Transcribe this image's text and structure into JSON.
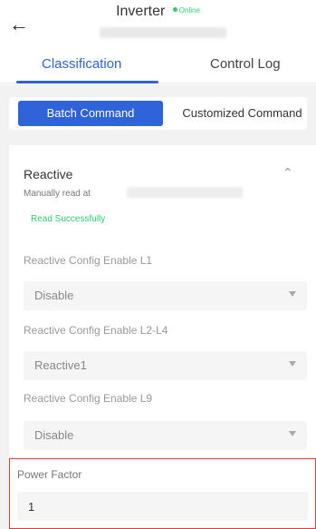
{
  "header": {
    "title": "Inverter",
    "status": "Online",
    "back_icon": "arrow-left-icon"
  },
  "tabs": [
    {
      "label": "Classification",
      "active": true
    },
    {
      "label": "Control Log",
      "active": false
    }
  ],
  "segment": {
    "batch_label": "Batch Command",
    "custom_label": "Customized Command",
    "active": "batch"
  },
  "card": {
    "title": "Reactive",
    "manual_read_label": "Manually read at",
    "read_status": "Read Successfully",
    "fields": [
      {
        "label": "Reactive Config Enable L1",
        "value": "Disable"
      },
      {
        "label": "Reactive Config Enable L2-L4",
        "value": "Reactive1"
      },
      {
        "label": "Reactive Config Enable L9",
        "value": "Disable"
      }
    ],
    "power_factor": {
      "label": "Power Factor",
      "value": "1"
    }
  },
  "colors": {
    "accent": "#2f63d9",
    "online": "#2ecc71",
    "highlight_border": "#e53935",
    "background_gray": "#f2f2f2"
  }
}
